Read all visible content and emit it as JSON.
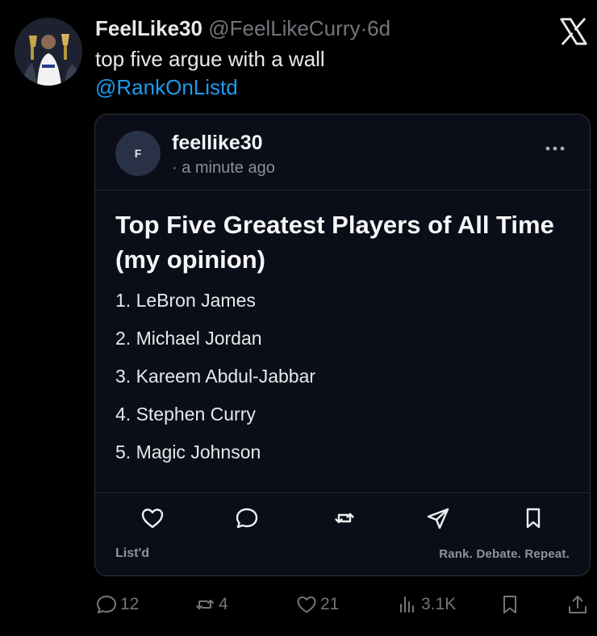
{
  "tweet": {
    "display_name": "FeelLike30",
    "handle": "@FeelLikeCurry",
    "separator": "·",
    "time": "6d",
    "text": "top five argue with a wall",
    "mention": "@RankOnListd",
    "avatar_icon": "player-trophies-avatar",
    "platform_icon": "x-logo-icon"
  },
  "card": {
    "avatar_letter": "F",
    "username": "feellike30",
    "time": "· a minute ago",
    "title": "Top Five Greatest Players of All Time (my opinion)",
    "items": [
      "1. LeBron James",
      "2. Michael Jordan",
      "3. Kareem Abdul-Jabbar",
      "4. Stephen Curry",
      "5. Magic Johnson"
    ],
    "actions": [
      "heart-icon",
      "comment-icon",
      "repost-icon",
      "share-icon",
      "bookmark-icon"
    ],
    "brand": "List'd",
    "tagline": "Rank. Debate. Repeat."
  },
  "stats": {
    "replies": "12",
    "reposts": "4",
    "likes": "21",
    "views": "3.1K"
  },
  "colors": {
    "background": "#000000",
    "card_background": "#0b0d18",
    "mention": "#1d9bf0",
    "muted": "#71767b"
  }
}
